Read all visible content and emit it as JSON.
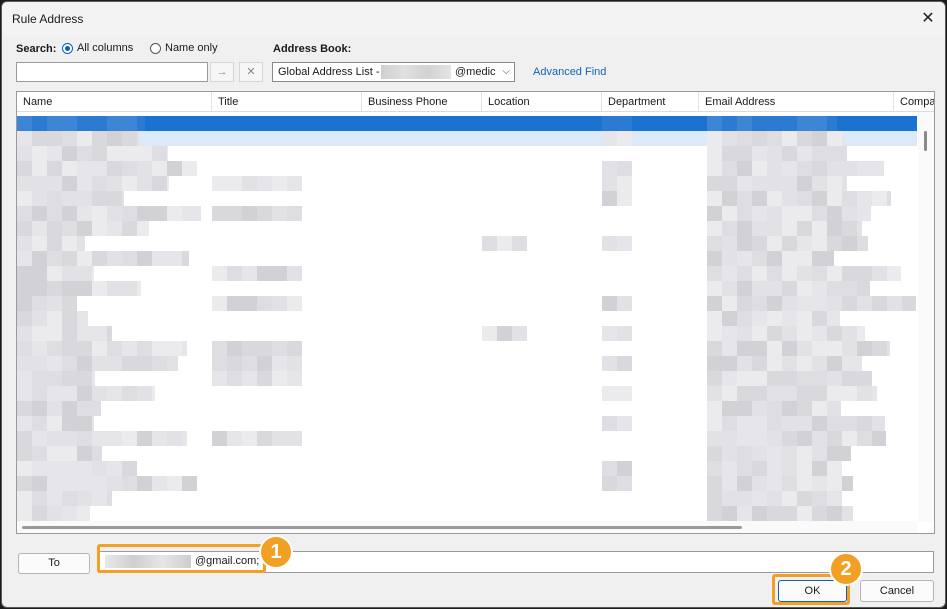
{
  "window": {
    "title": "Rule Address",
    "close_glyph": "✕"
  },
  "search": {
    "label": "Search:",
    "options": [
      {
        "label": "All columns",
        "selected": true
      },
      {
        "label": "Name only",
        "selected": false
      }
    ],
    "value": "",
    "go_glyph": "→",
    "clear_glyph": "✕"
  },
  "address_book": {
    "label": "Address Book:",
    "selected_prefix": "Global Address List -",
    "selected_suffix": "@medic",
    "chevron_glyph": "⌵",
    "advanced_find": "Advanced Find"
  },
  "columns": [
    "Name",
    "Title",
    "Business Phone",
    "Location",
    "Department",
    "Email Address",
    "Compa"
  ],
  "selected_row_color": "#1a73d1",
  "to": {
    "button_label": "To",
    "value_suffix": "@gmail.com;"
  },
  "annotations": [
    {
      "number": "1",
      "target": "to-field"
    },
    {
      "number": "2",
      "target": "ok-button"
    }
  ],
  "annotation_color": "#f2a024",
  "buttons": {
    "ok": "OK",
    "cancel": "Cancel"
  }
}
